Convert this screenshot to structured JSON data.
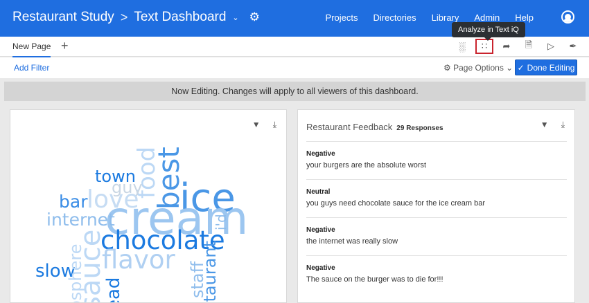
{
  "header": {
    "project": "Restaurant Study",
    "separator": ">",
    "dashboard": "Text Dashboard",
    "nav": [
      "Projects",
      "Directories",
      "Library",
      "Admin",
      "Help"
    ]
  },
  "tooltip": "Analyze in Text iQ",
  "tabs": {
    "current": "New Page",
    "add": "+"
  },
  "filterbar": {
    "add_filter": "Add Filter",
    "page_options": "Page Options",
    "done": "Done Editing"
  },
  "banner": "Now Editing. Changes will apply to all viewers of this dashboard.",
  "wordcloud": {
    "words": [
      "food",
      "best",
      "ice",
      "cream",
      "town",
      "guy",
      "love",
      "bar",
      "internet",
      "chocolate",
      "flavor",
      "slow",
      "sauce",
      "osphere",
      "ead",
      "staff",
      "staurant",
      "i'd"
    ]
  },
  "feedback": {
    "title": "Restaurant Feedback",
    "count": "29 Responses",
    "items": [
      {
        "sentiment": "Negative",
        "text": "your burgers are the absolute worst"
      },
      {
        "sentiment": "Neutral",
        "text": "you guys need chocolate sauce for the ice cream bar"
      },
      {
        "sentiment": "Negative",
        "text": "the internet was really slow"
      },
      {
        "sentiment": "Negative",
        "text": "The sauce on the burger was to die for!!!"
      }
    ]
  }
}
